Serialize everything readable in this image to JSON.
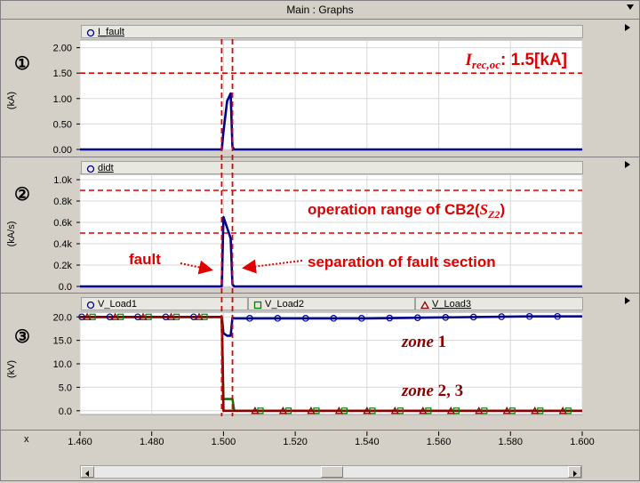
{
  "window": {
    "title": "Main : Graphs"
  },
  "panels": [
    {
      "number_label": "①",
      "legend": [
        {
          "name": "I_fault",
          "marker": "circle",
          "color": "#00008b"
        }
      ],
      "y_unit": "(kA)",
      "y_ticks": [
        "2.00",
        "1.50",
        "1.00",
        "0.50",
        "0.00"
      ],
      "ylim": [
        0,
        2.15
      ],
      "thresholds": [
        1.5
      ],
      "annotation": {
        "prefix": "I",
        "subscript": "rec,oc",
        "suffix": ": 1.5[kA]"
      }
    },
    {
      "number_label": "②",
      "legend": [
        {
          "name": "didt",
          "marker": "circle",
          "color": "#00008b"
        }
      ],
      "y_unit": "(kA/s)",
      "y_ticks": [
        "1.0k",
        "0.8k",
        "0.6k",
        "0.4k",
        "0.2k",
        "0.0"
      ],
      "ylim": [
        0,
        1.05
      ],
      "thresholds": [
        0.9,
        0.5
      ],
      "annotation_range": {
        "prefix": "operation range of CB2(",
        "math": "S",
        "subscript": "Z2",
        "suffix": ")"
      },
      "annotation_fault": "fault",
      "annotation_separation": "separation of fault section"
    },
    {
      "number_label": "③",
      "legend": [
        {
          "name": "V_Load1",
          "marker": "circle",
          "color": "#00008b"
        },
        {
          "name": "V_Load2",
          "marker": "square",
          "color": "#008000"
        },
        {
          "name": "V_Load3",
          "marker": "triangle",
          "color": "#8b0000"
        }
      ],
      "y_unit": "(kV)",
      "y_ticks": [
        "20.0",
        "15.0",
        "10.0",
        "5.0",
        "0.0"
      ],
      "ylim": [
        -0.8,
        21
      ],
      "annotation_zone1": {
        "word": "zone",
        "num": " 1"
      },
      "annotation_zone23": {
        "word": "zone",
        "num": " 2, 3"
      }
    }
  ],
  "x_axis": {
    "label": "x",
    "ticks": [
      "1.460",
      "1.480",
      "1.500",
      "1.520",
      "1.540",
      "1.560",
      "1.580",
      "1.600"
    ],
    "xlim": [
      1.46,
      1.6
    ],
    "event_lines": [
      1.4995,
      1.5025
    ]
  },
  "chart_data": [
    {
      "type": "line",
      "title": "",
      "xlabel": "x",
      "ylabel": "(kA)",
      "ylim": [
        0,
        2.15
      ],
      "series": [
        {
          "name": "I_fault",
          "x": [
            1.46,
            1.4995,
            1.5,
            1.501,
            1.502,
            1.5025,
            1.503,
            1.6
          ],
          "y": [
            0,
            0,
            0.35,
            0.95,
            1.1,
            0.05,
            0,
            0
          ]
        }
      ]
    },
    {
      "type": "line",
      "title": "",
      "xlabel": "x",
      "ylabel": "(kA/s)",
      "ylim": [
        0,
        1.05
      ],
      "series": [
        {
          "name": "didt",
          "x": [
            1.46,
            1.4995,
            1.5,
            1.501,
            1.502,
            1.5025,
            1.503,
            1.6
          ],
          "y": [
            0,
            0,
            0.65,
            0.55,
            0.45,
            0.02,
            0,
            0
          ]
        }
      ]
    },
    {
      "type": "line",
      "title": "",
      "xlabel": "x",
      "ylabel": "(kV)",
      "ylim": [
        -0.8,
        21
      ],
      "series": [
        {
          "name": "V_Load1",
          "x": [
            1.46,
            1.4995,
            1.5,
            1.501,
            1.502,
            1.5025,
            1.503,
            1.54,
            1.585,
            1.6
          ],
          "y": [
            20,
            20,
            16.5,
            16,
            16,
            19.8,
            19.7,
            19.7,
            20.1,
            20.1
          ]
        },
        {
          "name": "V_Load2",
          "x": [
            1.46,
            1.4995,
            1.5,
            1.5025,
            1.503,
            1.6
          ],
          "y": [
            20,
            20,
            2.5,
            2.5,
            0,
            0
          ]
        },
        {
          "name": "V_Load3",
          "x": [
            1.46,
            1.4995,
            1.5,
            1.503,
            1.6
          ],
          "y": [
            20,
            20,
            0,
            0,
            0
          ]
        }
      ]
    }
  ]
}
